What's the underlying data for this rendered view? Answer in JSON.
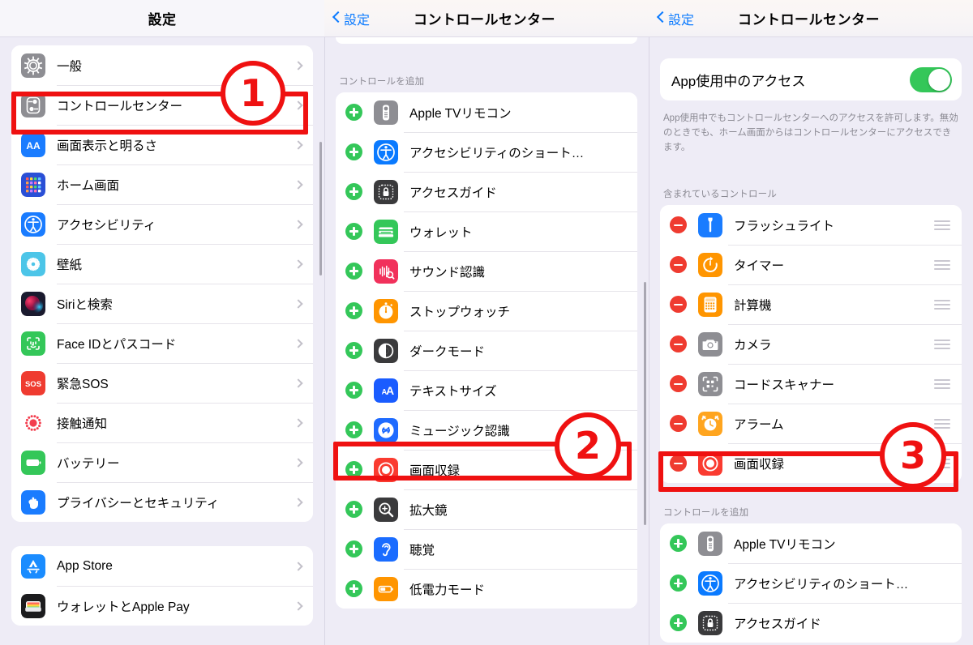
{
  "meta": {
    "accent_blue": "#0a7aff",
    "annotation_red": "#ef1111",
    "green": "#34c759",
    "red": "#ef3b30",
    "orange": "#ff9500"
  },
  "panel1": {
    "nav": {
      "title": "設定"
    },
    "group1": [
      {
        "label": "一般",
        "icon": "gear-icon",
        "icon_bg": "#8e8e93"
      },
      {
        "label": "コントロールセンター",
        "icon": "control-center-icon",
        "icon_bg": "#8e8e93"
      },
      {
        "label": "画面表示と明るさ",
        "icon": "display-brightness-icon",
        "icon_bg": "#1a7cff"
      },
      {
        "label": "ホーム画面",
        "icon": "home-screen-icon",
        "icon_bg": "#2a4fd6"
      },
      {
        "label": "アクセシビリティ",
        "icon": "accessibility-icon",
        "icon_bg": "#1a7cff"
      },
      {
        "label": "壁紙",
        "icon": "wallpaper-icon",
        "icon_bg": "#4cc5e8"
      },
      {
        "label": "Siriと検索",
        "icon": "siri-icon",
        "icon_bg": "#1a1a2e"
      },
      {
        "label": "Face IDとパスコード",
        "icon": "faceid-icon",
        "icon_bg": "#34c759"
      },
      {
        "label": "緊急SOS",
        "icon": "sos-icon",
        "icon_bg": "#ef3b30"
      },
      {
        "label": "接触通知",
        "icon": "exposure-notification-icon",
        "icon_bg": "#ffffff"
      },
      {
        "label": "バッテリー",
        "icon": "battery-icon",
        "icon_bg": "#34c759"
      },
      {
        "label": "プライバシーとセキュリティ",
        "icon": "privacy-hand-icon",
        "icon_bg": "#1a7cff"
      }
    ],
    "group2": [
      {
        "label": "App Store",
        "icon": "app-store-icon",
        "icon_bg": "#1a8cff"
      },
      {
        "label": "ウォレットとApple Pay",
        "icon": "wallet-icon",
        "icon_bg": "#1c1c1e"
      }
    ]
  },
  "panel2": {
    "nav": {
      "back": "設定",
      "title": "コントロールセンター"
    },
    "add_section_header": "コントロールを追加",
    "add_items": [
      {
        "label": "Apple TVリモコン",
        "icon": "apple-tv-remote-icon",
        "icon_bg": "#8e8e93",
        "action": "add"
      },
      {
        "label": "アクセシビリティのショート…",
        "icon": "accessibility-icon",
        "icon_bg": "#0a7aff",
        "action": "add"
      },
      {
        "label": "アクセスガイド",
        "icon": "guided-access-icon",
        "icon_bg": "#3a3a3c",
        "action": "add"
      },
      {
        "label": "ウォレット",
        "icon": "wallet-green-icon",
        "icon_bg": "#34c759",
        "action": "add"
      },
      {
        "label": "サウンド認識",
        "icon": "sound-recognition-icon",
        "icon_bg": "#f1315b",
        "action": "add"
      },
      {
        "label": "ストップウォッチ",
        "icon": "stopwatch-icon",
        "icon_bg": "#ff9500",
        "action": "add"
      },
      {
        "label": "ダークモード",
        "icon": "dark-mode-icon",
        "icon_bg": "#3a3a3c",
        "action": "add"
      },
      {
        "label": "テキストサイズ",
        "icon": "text-size-icon",
        "icon_bg": "#1a5cff",
        "action": "add"
      },
      {
        "label": "ミュージック認識",
        "icon": "shazam-icon",
        "icon_bg": "#1f6bff",
        "action": "add"
      },
      {
        "label": "画面収録",
        "icon": "screen-recording-icon",
        "icon_bg": "#fa3b30",
        "action": "add"
      },
      {
        "label": "拡大鏡",
        "icon": "magnifier-icon",
        "icon_bg": "#3a3a3c",
        "action": "add"
      },
      {
        "label": "聴覚",
        "icon": "hearing-icon",
        "icon_bg": "#1a6cff",
        "action": "add"
      },
      {
        "label": "低電力モード",
        "icon": "low-power-icon",
        "icon_bg": "#ff9500",
        "action": "add"
      }
    ]
  },
  "panel3": {
    "nav": {
      "back": "設定",
      "title": "コントロールセンター"
    },
    "toggle": {
      "label": "App使用中のアクセス",
      "state": "on"
    },
    "toggle_note": "App使用中でもコントロールセンターへのアクセスを許可します。無効のときでも、ホーム画面からはコントロールセンターにアクセスできます。",
    "included_section_header": "含まれているコントロール",
    "included_items": [
      {
        "label": "フラッシュライト",
        "icon": "flashlight-icon",
        "icon_bg": "#1a7cff"
      },
      {
        "label": "タイマー",
        "icon": "timer-icon",
        "icon_bg": "#ff9500"
      },
      {
        "label": "計算機",
        "icon": "calculator-icon",
        "icon_bg": "#ff9500"
      },
      {
        "label": "カメラ",
        "icon": "camera-icon",
        "icon_bg": "#8e8e93"
      },
      {
        "label": "コードスキャナー",
        "icon": "code-scanner-icon",
        "icon_bg": "#8e8e93"
      },
      {
        "label": "アラーム",
        "icon": "alarm-icon",
        "icon_bg": "#ffa51f"
      },
      {
        "label": "画面収録",
        "icon": "screen-recording-icon",
        "icon_bg": "#fa3b30"
      }
    ],
    "add_section_header": "コントロールを追加",
    "add_items": [
      {
        "label": "Apple TVリモコン",
        "icon": "apple-tv-remote-icon",
        "icon_bg": "#8e8e93"
      },
      {
        "label": "アクセシビリティのショート…",
        "icon": "accessibility-icon",
        "icon_bg": "#0a7aff"
      },
      {
        "label": "アクセスガイド",
        "icon": "guided-access-icon",
        "icon_bg": "#3a3a3c"
      }
    ]
  },
  "annotations": {
    "step1": "1",
    "step2": "2",
    "step3": "3"
  }
}
